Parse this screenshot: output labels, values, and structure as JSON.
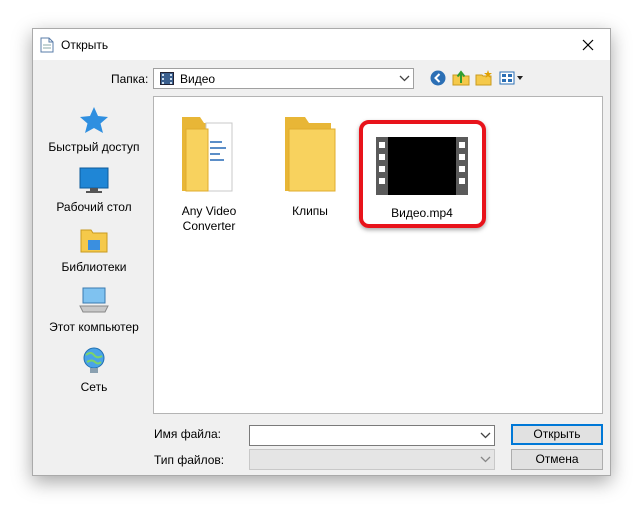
{
  "window": {
    "title": "Открыть"
  },
  "toolbar": {
    "lookin_label": "Папка:",
    "lookin_value": "Видео",
    "back_icon": "back-arrow-icon",
    "up_icon": "up-folder-icon",
    "newfolder_icon": "new-folder-icon",
    "views_icon": "view-menu-icon"
  },
  "places": [
    {
      "label": "Быстрый доступ",
      "icon": "star-icon"
    },
    {
      "label": "Рабочий стол",
      "icon": "desktop-icon"
    },
    {
      "label": "Библиотеки",
      "icon": "libraries-icon"
    },
    {
      "label": "Этот компьютер",
      "icon": "computer-icon"
    },
    {
      "label": "Сеть",
      "icon": "network-icon"
    }
  ],
  "files": [
    {
      "label_line1": "Any Video",
      "label_line2": "Converter",
      "type": "folder-with-content"
    },
    {
      "label_line1": "Клипы",
      "label_line2": "",
      "type": "folder"
    },
    {
      "label_line1": "Видео.mp4",
      "label_line2": "",
      "type": "video-file",
      "highlighted": true
    }
  ],
  "bottom": {
    "filename_label": "Имя файла:",
    "filename_value": "",
    "filetype_label": "Тип файлов:",
    "filetype_value": "",
    "open_label": "Открыть",
    "cancel_label": "Отмена"
  },
  "colors": {
    "highlight": "#e8131b",
    "folder": "#f5c94a",
    "accent": "#0078d7"
  }
}
